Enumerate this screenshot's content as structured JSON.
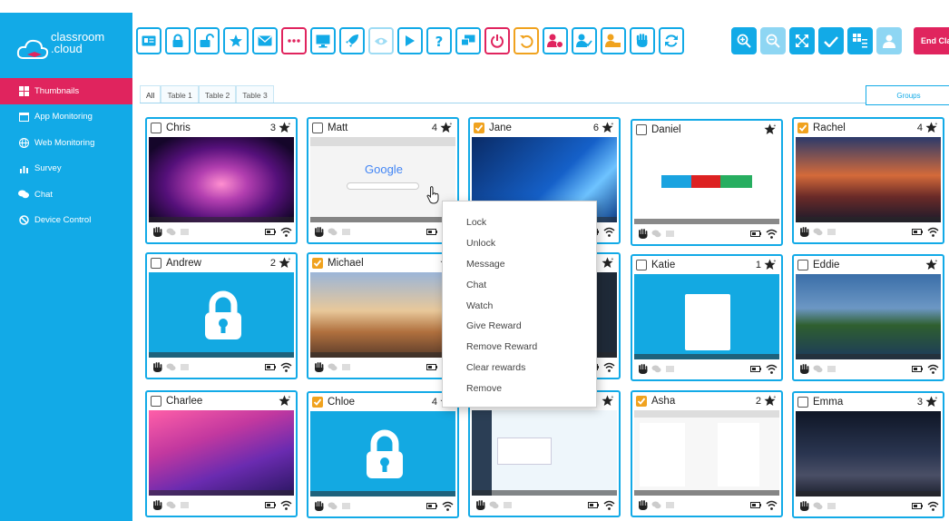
{
  "app": {
    "logo_line1": "classroom",
    "logo_line2": ".cloud",
    "end_class": "End Class"
  },
  "sidebar": {
    "items": [
      {
        "label": "Thumbnails",
        "icon": "grid-icon",
        "active": true
      },
      {
        "label": "App Monitoring",
        "icon": "window-icon",
        "active": false
      },
      {
        "label": "Web Monitoring",
        "icon": "globe-icon",
        "active": false
      },
      {
        "label": "Survey",
        "icon": "bar-chart-icon",
        "active": false
      },
      {
        "label": "Chat",
        "icon": "chat-icon",
        "active": false
      },
      {
        "label": "Device Control",
        "icon": "ban-icon",
        "active": false
      }
    ]
  },
  "toolbar": {
    "buttons": [
      "register-icon",
      "lock-icon",
      "unlock-icon",
      "reward-icon",
      "message-icon",
      "dots-icon",
      "monitor-icon",
      "rocket-icon",
      "eye-icon",
      "play-icon",
      "help-icon",
      "screen-share-icon",
      "power-icon",
      "undo-icon",
      "user-remove-icon",
      "user-check-icon",
      "user-lock-icon",
      "hand-icon",
      "refresh-icon",
      "zoom-in-icon",
      "zoom-out-icon",
      "fullscreen-icon",
      "check-icon",
      "grid-list-icon",
      "user-icon"
    ]
  },
  "tabs": [
    "All",
    "Table 1",
    "Table 2",
    "Table 3"
  ],
  "groups_label": "Groups",
  "students": [
    {
      "name": "Chris",
      "count": "3",
      "checked": false
    },
    {
      "name": "Matt",
      "count": "4",
      "checked": false
    },
    {
      "name": "Jane",
      "count": "6",
      "checked": true
    },
    {
      "name": "Daniel",
      "count": "",
      "checked": false
    },
    {
      "name": "Rachel",
      "count": "4",
      "checked": true
    },
    {
      "name": "Andrew",
      "count": "2",
      "checked": false
    },
    {
      "name": "Michael",
      "count": "",
      "checked": true
    },
    {
      "name": "",
      "count": "",
      "checked": false
    },
    {
      "name": "Katie",
      "count": "1",
      "checked": false
    },
    {
      "name": "Eddie",
      "count": "",
      "checked": false
    },
    {
      "name": "Charlee",
      "count": "",
      "checked": false
    },
    {
      "name": "Chloe",
      "count": "4",
      "checked": true
    },
    {
      "name": "",
      "count": "",
      "checked": false
    },
    {
      "name": "Asha",
      "count": "2",
      "checked": true
    },
    {
      "name": "Emma",
      "count": "3",
      "checked": false
    }
  ],
  "context_menu": {
    "items": [
      "Lock",
      "Unlock",
      "Message",
      "Chat",
      "Watch",
      "Give Reward",
      "Remove Reward",
      "Clear rewards",
      "Remove"
    ]
  },
  "screens": {
    "google_logo": "Google"
  },
  "colors": {
    "brand_blue": "#12aae7",
    "accent_red": "#e0245e",
    "check_orange": "#f0a21e"
  }
}
